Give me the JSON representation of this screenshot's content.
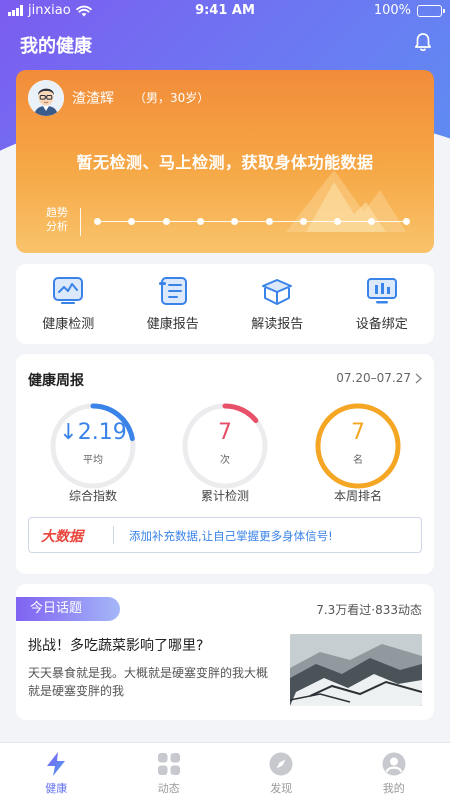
{
  "status_bar": {
    "carrier": "jinxiao",
    "time": "9:41 AM",
    "battery": "100%"
  },
  "header": {
    "title": "我的健康"
  },
  "health_card": {
    "user_name": "渣渣辉",
    "user_info": "（男，30岁）",
    "headline": "暂无检测、马上检测，获取身体功能数据",
    "trend_label": "趋势分析"
  },
  "quick_actions": [
    {
      "label": "健康检测",
      "icon": "health-check-icon"
    },
    {
      "label": "健康报告",
      "icon": "health-report-icon"
    },
    {
      "label": "解读报告",
      "icon": "interpret-report-icon"
    },
    {
      "label": "设备绑定",
      "icon": "device-bind-icon"
    }
  ],
  "weekly_report": {
    "title": "健康周报",
    "date_range": "07.20–07.27",
    "metrics": [
      {
        "value": "↓2.19",
        "unit": "平均",
        "caption": "综合指数",
        "color": "#3a83e8",
        "progress": 0.22
      },
      {
        "value": "7",
        "unit": "次",
        "caption": "累计检测",
        "color": "#e8506a",
        "progress": 0.14
      },
      {
        "value": "7",
        "unit": "名",
        "caption": "本周排名",
        "color": "#f5a623",
        "progress": 1.0
      }
    ],
    "bigdata": {
      "tag": "大数据",
      "message": "添加补充数据,让自己掌握更多身体信号!"
    }
  },
  "today_topic": {
    "badge": "今日话题",
    "stats": "7.3万看过·833动态",
    "headline": "挑战！多吃蔬菜影响了哪里?",
    "body": "天天暴食就是我。大概就是硬塞变胖的我大概就是硬塞变胖的我"
  },
  "tabbar": [
    {
      "label": "健康",
      "icon": "lightning-icon",
      "active": true
    },
    {
      "label": "动态",
      "icon": "grid-icon",
      "active": false
    },
    {
      "label": "发现",
      "icon": "compass-icon",
      "active": false
    },
    {
      "label": "我的",
      "icon": "profile-icon",
      "active": false
    }
  ],
  "colors": {
    "accent": "#6272ee",
    "card_orange": "#f28c3a",
    "bigdata_red": "#e8453c",
    "link_blue": "#3a83e8"
  }
}
